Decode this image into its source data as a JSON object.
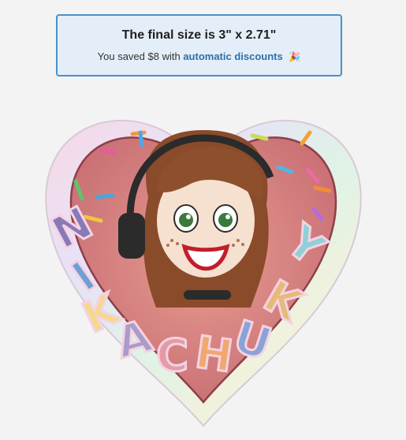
{
  "banner": {
    "title": "The final size is 3\" x 2.71\"",
    "saved_prefix": "You saved $8 with",
    "link_label": "automatic discounts",
    "party_emoji": "🎉"
  },
  "sticker": {
    "name_letters": [
      "N",
      "I",
      "K",
      "A",
      "C",
      "H",
      "U",
      "K",
      "Y"
    ],
    "colors": {
      "heart_outer": "#e9e4f2",
      "heart_fill": "#e08a87",
      "hair": "#8a4b2a",
      "headphones": "#2b2b2b",
      "skin": "#f6e0cf"
    }
  }
}
